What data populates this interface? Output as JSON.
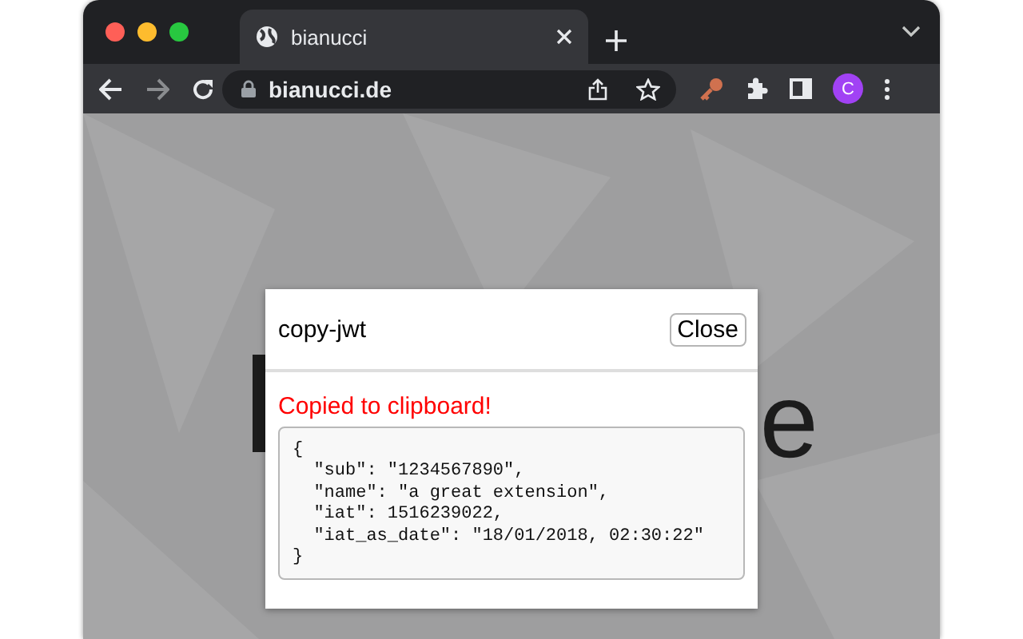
{
  "browser": {
    "tab": {
      "title": "bianucci",
      "selected": true
    },
    "url": "bianucci.de",
    "profile_initial": "C"
  },
  "page": {
    "heading_fragment": "e"
  },
  "popup": {
    "title": "copy-jwt",
    "close_button": "Close",
    "message": "Copied to clipboard!",
    "output_lines": [
      "{",
      "  \"sub\": \"1234567890\",",
      "  \"name\": \"a great extension\",",
      "  \"iat\": 1516239022,",
      "  \"iat_as_date\": \"18/01/2018, 02:30:22\"",
      "}"
    ]
  }
}
